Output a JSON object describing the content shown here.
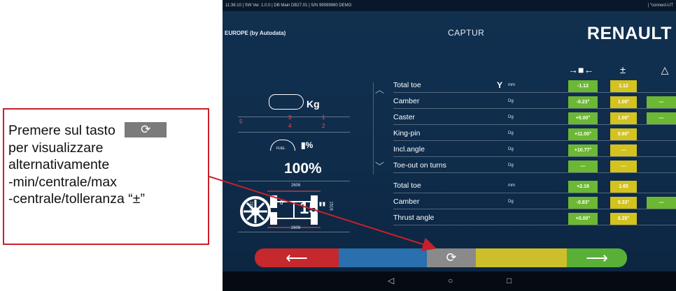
{
  "callout": {
    "line1": "Premere sul tasto",
    "button_glyph": "⟳",
    "line2": "per visualizzare",
    "line3": "alternativamente",
    "line4": "-min/centrale/max",
    "line5": "-centrale/tolleranza “±”"
  },
  "status_bar": {
    "left": "11:36:10  |  SW Ver. 1.0.0  |  DB Main DB27.01  |  S/N 99999980 DEMO",
    "right": "|  \"connect-UT"
  },
  "header": {
    "region": "EUROPE (by Autodata)",
    "model": "CAPTUR",
    "brand": "RENAULT"
  },
  "column_headers": {
    "range_icon": "→■←",
    "tolerance": "±",
    "delta_icon": "△"
  },
  "left_panel": {
    "weight_unit": "Kg",
    "wheel_numbers": [
      "5",
      "3",
      "1",
      "4",
      "2"
    ],
    "fuel_label": "FUEL",
    "fuel_symbol": "%",
    "fuel_percent": "100%",
    "wheelbase_top": "2606",
    "wheelbase_bottom": "2606",
    "track_left": "1531",
    "track_right": "1516",
    "axle_zero": "0",
    "tire_size": "15\""
  },
  "table": {
    "front": [
      {
        "name": "Total toe",
        "unit": "mm",
        "value": "-1.12",
        "tol": "1.12",
        "extra": "",
        "tool_icon": true
      },
      {
        "name": "Camber",
        "unit": "Dg",
        "value": "-0.23°",
        "tol": "1.00°",
        "extra": "---"
      },
      {
        "name": "Caster",
        "unit": "Dg",
        "value": "+5.00°",
        "tol": "1.00°",
        "extra": "---"
      },
      {
        "name": "King-pin",
        "unit": "Dg",
        "value": "+11.00°",
        "tol": "0.60°",
        "extra": ""
      },
      {
        "name": "Incl.angle",
        "unit": "Dg",
        "value": "+10.77°",
        "tol": "---",
        "extra": ""
      },
      {
        "name": "Toe-out on turns",
        "unit": "Dg",
        "value": "---",
        "tol": "---",
        "extra": ""
      }
    ],
    "rear": [
      {
        "name": "Total toe",
        "unit": "mm",
        "value": "+2.18",
        "tol": "1.65",
        "extra": ""
      },
      {
        "name": "Camber",
        "unit": "Dg",
        "value": "-0.83°",
        "tol": "0.33°",
        "extra": "---"
      },
      {
        "name": "Thrust angle",
        "unit": "",
        "value": "+0.00°",
        "tol": "0.25°",
        "extra": ""
      }
    ]
  },
  "bottom_bar": {
    "back": "⟵",
    "refresh": "⟳",
    "next": "⟶"
  },
  "nav": {
    "back": "◁",
    "home": "○",
    "recent": "□"
  },
  "colors": {
    "value_green": "#6cb832",
    "tolerance_yellow": "#d4c21e",
    "callout_red": "#c8202a",
    "back_red": "#c5282d",
    "next_green": "#58b037"
  }
}
